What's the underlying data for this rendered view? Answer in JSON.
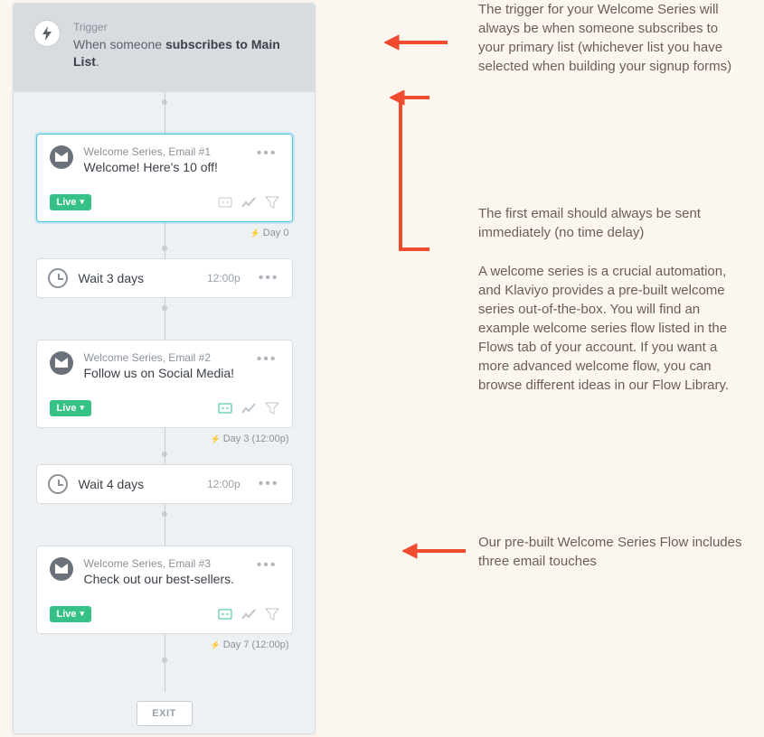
{
  "trigger": {
    "label": "Trigger",
    "prefix": "When someone ",
    "bold": "subscribes to Main List",
    "suffix": "."
  },
  "emails": [
    {
      "name": "Welcome Series, Email #1",
      "subject": "Welcome! Here's 10 off!",
      "status": "Live",
      "selected": true,
      "icons_on": false,
      "stamp": "Day 0"
    },
    {
      "name": "Welcome Series, Email #2",
      "subject": "Follow us on Social Media!",
      "status": "Live",
      "selected": false,
      "icons_on": true,
      "stamp": "Day 3 (12:00p)"
    },
    {
      "name": "Welcome Series, Email #3",
      "subject": "Check out our best-sellers.",
      "status": "Live",
      "selected": false,
      "icons_on": true,
      "stamp": "Day 7 (12:00p)"
    }
  ],
  "waits": [
    {
      "label": "Wait 3 days",
      "time": "12:00p"
    },
    {
      "label": "Wait 4 days",
      "time": "12:00p"
    }
  ],
  "exit": "EXIT",
  "annotations": {
    "a1": "The trigger for your Welcome Series will always be when someone subscribes to your primary list (whichever list you have selected when building your signup forms)",
    "a2": "The first email should always be sent immediately (no time delay)",
    "a3": "A welcome series is a crucial automation, and Klaviyo provides a pre-built welcome series out-of-the-box. You will find an example welcome series flow listed in the Flows tab of your account. If you want a more advanced welcome flow, you can browse different ideas in our Flow Library.",
    "a4": "Our pre-built Welcome Series Flow includes three email touches"
  }
}
